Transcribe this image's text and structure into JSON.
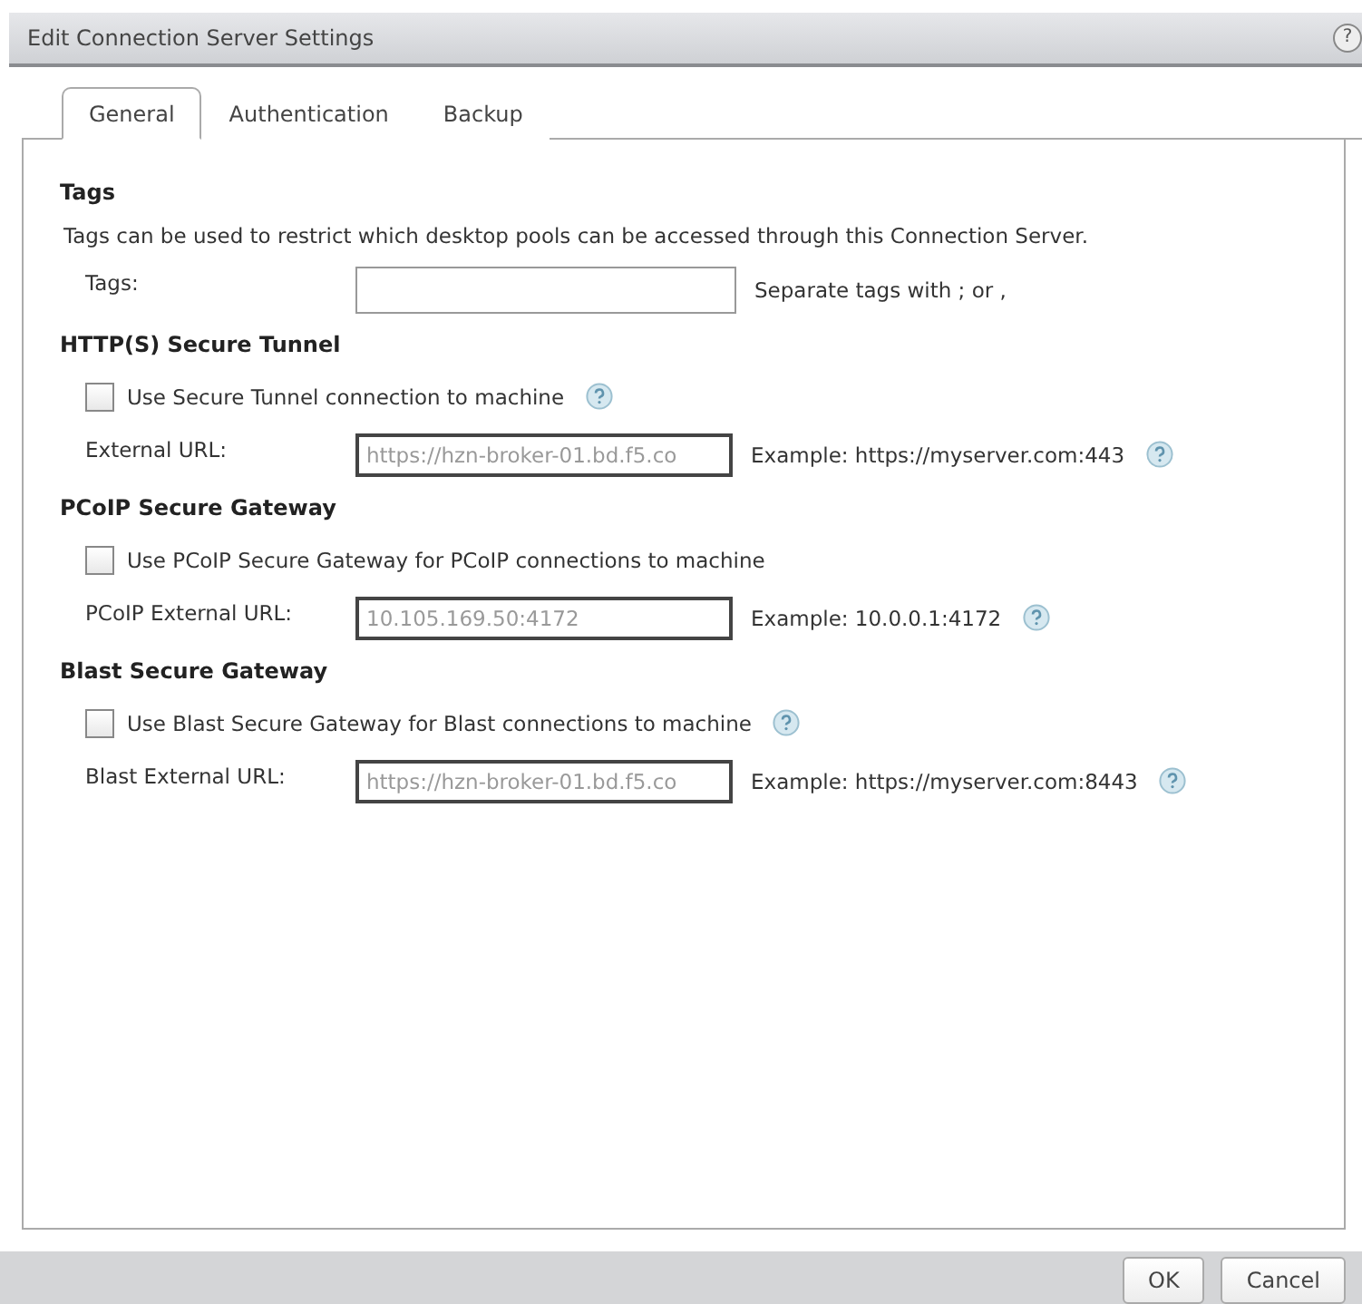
{
  "window": {
    "title": "Edit Connection Server Settings",
    "help": "?"
  },
  "tabs": [
    {
      "label": "General",
      "selected": true
    },
    {
      "label": "Authentication",
      "selected": false
    },
    {
      "label": "Backup",
      "selected": false
    }
  ],
  "sections": [
    {
      "heading": "Tags",
      "description": "Tags can be used to restrict which desktop pools can be accessed through this Connection Server.",
      "rows": [
        {
          "kind": "field",
          "label": "Tags:",
          "value": "",
          "disabled": false,
          "hint": "Separate tags with ; or ,",
          "help": false
        }
      ]
    },
    {
      "heading": "HTTP(S) Secure Tunnel",
      "rows": [
        {
          "kind": "checkbox",
          "label": "Use Secure Tunnel connection to machine",
          "checked": false,
          "help": true
        },
        {
          "kind": "field",
          "label": "External URL:",
          "value": "https://hzn-broker-01.bd.f5.co",
          "disabled": true,
          "hint": "Example: https://myserver.com:443",
          "help": true
        }
      ]
    },
    {
      "heading": "PCoIP Secure Gateway",
      "rows": [
        {
          "kind": "checkbox",
          "label": "Use PCoIP Secure Gateway for PCoIP connections to machine",
          "checked": false,
          "help": false
        },
        {
          "kind": "field",
          "label": "PCoIP External URL:",
          "value": "10.105.169.50:4172",
          "disabled": true,
          "hint": "Example: 10.0.0.1:4172",
          "help": true
        }
      ]
    },
    {
      "heading": "Blast Secure Gateway",
      "rows": [
        {
          "kind": "checkbox",
          "label": "Use Blast Secure Gateway for Blast connections to machine",
          "checked": false,
          "help": true
        },
        {
          "kind": "field",
          "label": "Blast External URL:",
          "value": "https://hzn-broker-01.bd.f5.co",
          "disabled": true,
          "hint": "Example: https://myserver.com:8443",
          "help": true
        }
      ]
    }
  ],
  "buttons": [
    "OK",
    "Cancel"
  ]
}
